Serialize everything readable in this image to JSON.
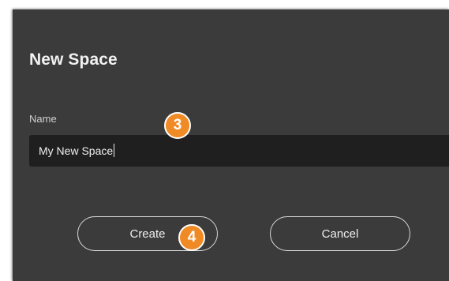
{
  "dialog": {
    "title": "New Space",
    "name_label": "Name",
    "name_value": "My New Space",
    "create_label": "Create",
    "cancel_label": "Cancel"
  },
  "annotations": {
    "step_a": "3",
    "step_b": "4",
    "badge_color": "#f08a24"
  },
  "colors": {
    "dialog_bg": "#3b3b3b",
    "field_bg": "#1f1f1f"
  }
}
